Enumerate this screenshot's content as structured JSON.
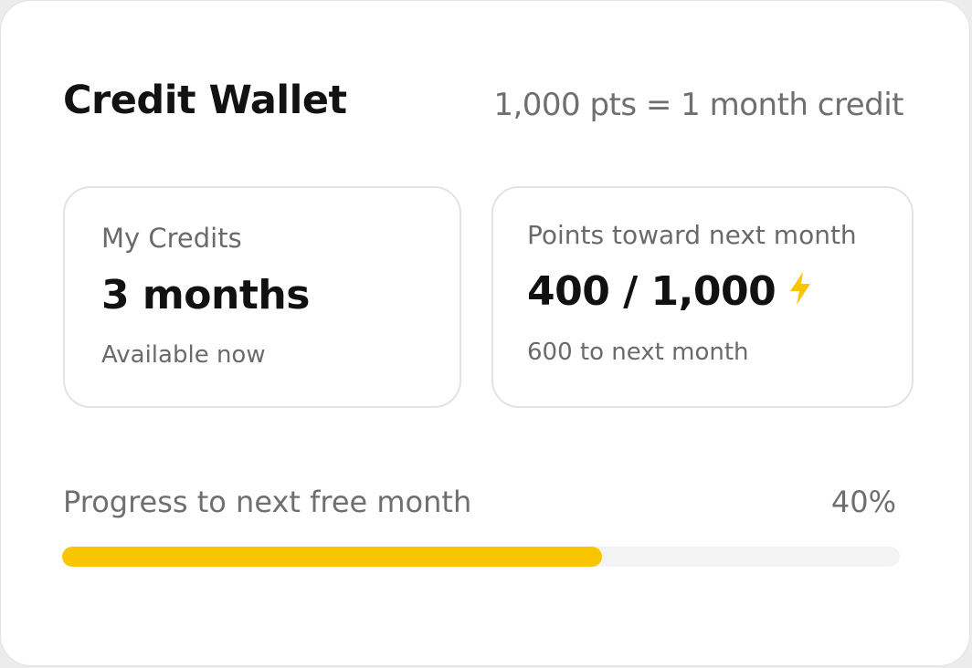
{
  "header": {
    "title": "Credit Wallet",
    "rate": "1,000 pts = 1 month credit"
  },
  "credits_card": {
    "label": "My Credits",
    "value": "3 months",
    "sub": "Available now"
  },
  "points_card": {
    "label": "Points toward next month",
    "value": "400 / 1,000",
    "icon": "lightning-bolt-icon",
    "sub": "600 to next month"
  },
  "progress": {
    "label": "Progress to next free month",
    "percent_text": "40%",
    "fraction": 0.644,
    "fill_color": "#f9c400",
    "track_color": "#f3f3f3"
  }
}
